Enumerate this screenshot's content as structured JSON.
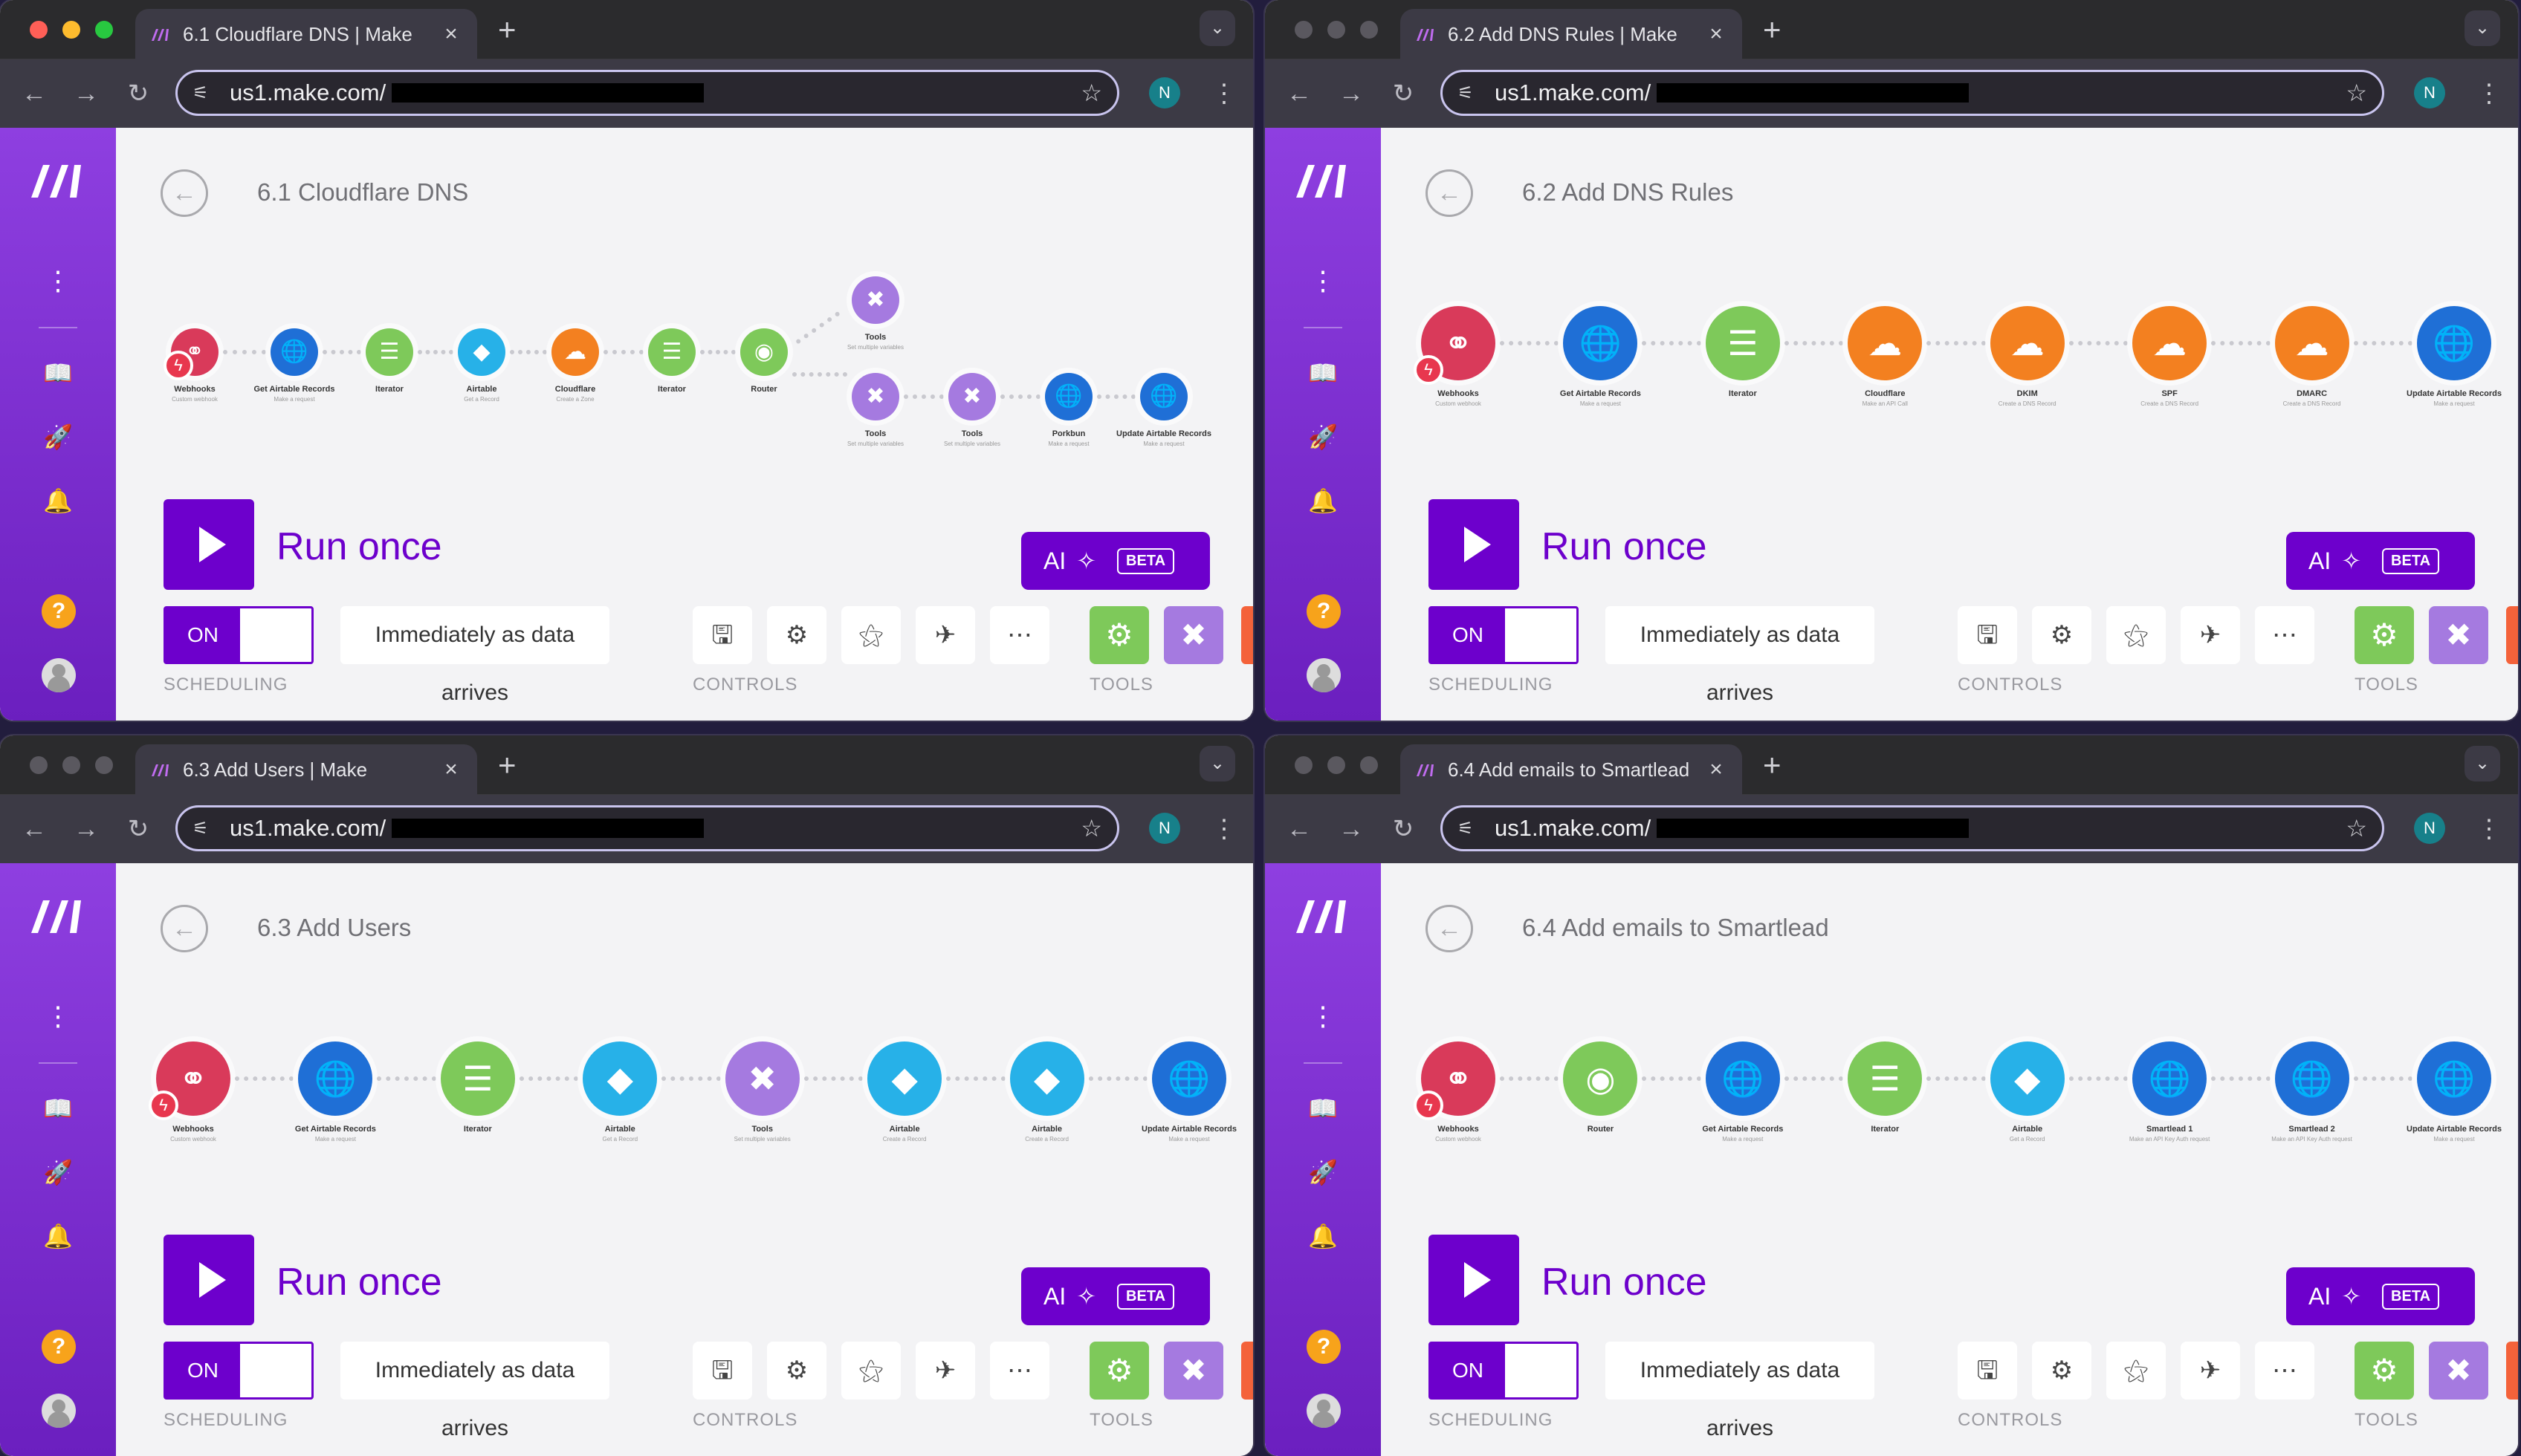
{
  "browser": {
    "url_prefix": "us1.make.com/",
    "profile_initial": "N",
    "new_tab": "+",
    "tab_close": "×",
    "icons": {
      "back": "arrow-left-icon",
      "forward": "arrow-right-icon",
      "reload": "reload-icon",
      "site-settings": "tune-icon",
      "bookmark": "star-icon",
      "menu": "kebab-icon"
    }
  },
  "windows": [
    {
      "tab_title": "6.1 Cloudflare DNS | Make",
      "scenario_title": "6.1 Cloudflare DNS",
      "active": true
    },
    {
      "tab_title": "6.2 Add DNS Rules | Make",
      "scenario_title": "6.2 Add DNS Rules",
      "active": false
    },
    {
      "tab_title": "6.3 Add Users | Make",
      "scenario_title": "6.3 Add Users",
      "active": false
    },
    {
      "tab_title": "6.4 Add emails to Smartlead |",
      "scenario_title": "6.4 Add emails to Smartlead",
      "active": false
    }
  ],
  "flows": [
    [
      {
        "label": "Webhooks",
        "sub": "Custom webhook",
        "color": "#d93a5a",
        "icon": "webhook-icon"
      },
      {
        "label": "Get Airtable Records",
        "sub": "Make a request",
        "color": "#1f6fd6",
        "icon": "globe-icon"
      },
      {
        "label": "Iterator",
        "sub": "",
        "color": "#7ec95a",
        "icon": "iterator-icon"
      },
      {
        "label": "Airtable",
        "sub": "Get a Record",
        "color": "#27b1e8",
        "icon": "airtable-icon"
      },
      {
        "label": "Cloudflare",
        "sub": "Create a Zone",
        "color": "#f38020",
        "icon": "cloud-icon"
      },
      {
        "label": "Iterator",
        "sub": "",
        "color": "#7ec95a",
        "icon": "iterator-icon"
      },
      {
        "label": "Router",
        "sub": "",
        "color": "#7ec95a",
        "icon": "router-icon"
      },
      {
        "label": "Tools",
        "sub": "Set multiple variables",
        "color": "#a57ae0",
        "icon": "tools-icon"
      },
      {
        "label": "Tools",
        "sub": "Set multiple variables",
        "color": "#a57ae0",
        "icon": "tools-icon"
      },
      {
        "label": "Tools",
        "sub": "Set multiple variables",
        "color": "#a57ae0",
        "icon": "tools-icon"
      },
      {
        "label": "Porkbun",
        "sub": "Make a request",
        "color": "#1f6fd6",
        "icon": "globe-icon"
      },
      {
        "label": "Update Airtable Records",
        "sub": "Make a request",
        "color": "#1f6fd6",
        "icon": "globe-icon"
      }
    ],
    [
      {
        "label": "Webhooks",
        "sub": "Custom webhook",
        "color": "#d93a5a",
        "icon": "webhook-icon"
      },
      {
        "label": "Get Airtable Records",
        "sub": "Make a request",
        "color": "#1f6fd6",
        "icon": "globe-icon"
      },
      {
        "label": "Iterator",
        "sub": "",
        "color": "#7ec95a",
        "icon": "iterator-icon"
      },
      {
        "label": "Cloudflare",
        "sub": "Make an API Call",
        "color": "#f38020",
        "icon": "cloud-icon"
      },
      {
        "label": "DKIM",
        "sub": "Create a DNS Record",
        "color": "#f38020",
        "icon": "cloud-icon"
      },
      {
        "label": "SPF",
        "sub": "Create a DNS Record",
        "color": "#f38020",
        "icon": "cloud-icon"
      },
      {
        "label": "DMARC",
        "sub": "Create a DNS Record",
        "color": "#f38020",
        "icon": "cloud-icon"
      },
      {
        "label": "Update Airtable Records",
        "sub": "Make a request",
        "color": "#1f6fd6",
        "icon": "globe-icon"
      }
    ],
    [
      {
        "label": "Webhooks",
        "sub": "Custom webhook",
        "color": "#d93a5a",
        "icon": "webhook-icon"
      },
      {
        "label": "Get Airtable Records",
        "sub": "Make a request",
        "color": "#1f6fd6",
        "icon": "globe-icon"
      },
      {
        "label": "Iterator",
        "sub": "",
        "color": "#7ec95a",
        "icon": "iterator-icon"
      },
      {
        "label": "Airtable",
        "sub": "Get a Record",
        "color": "#27b1e8",
        "icon": "airtable-icon"
      },
      {
        "label": "Tools",
        "sub": "Set multiple variables",
        "color": "#a57ae0",
        "icon": "tools-icon"
      },
      {
        "label": "Airtable",
        "sub": "Create a Record",
        "color": "#27b1e8",
        "icon": "airtable-icon"
      },
      {
        "label": "Airtable",
        "sub": "Create a Record",
        "color": "#27b1e8",
        "icon": "airtable-icon"
      },
      {
        "label": "Update Airtable Records",
        "sub": "Make a request",
        "color": "#1f6fd6",
        "icon": "globe-icon"
      }
    ],
    [
      {
        "label": "Webhooks",
        "sub": "Custom webhook",
        "color": "#d93a5a",
        "icon": "webhook-icon"
      },
      {
        "label": "Router",
        "sub": "",
        "color": "#7ec95a",
        "icon": "router-icon"
      },
      {
        "label": "Get Airtable Records",
        "sub": "Make a request",
        "color": "#1f6fd6",
        "icon": "globe-icon"
      },
      {
        "label": "Iterator",
        "sub": "",
        "color": "#7ec95a",
        "icon": "iterator-icon"
      },
      {
        "label": "Airtable",
        "sub": "Get a Record",
        "color": "#27b1e8",
        "icon": "airtable-icon"
      },
      {
        "label": "Smartlead 1",
        "sub": "Make an API Key Auth request",
        "color": "#1f6fd6",
        "icon": "globe-icon"
      },
      {
        "label": "Smartlead 2",
        "sub": "Make an API Key Auth request",
        "color": "#1f6fd6",
        "icon": "globe-icon"
      },
      {
        "label": "Update Airtable Records",
        "sub": "Make a request",
        "color": "#1f6fd6",
        "icon": "globe-icon"
      }
    ]
  ],
  "editor": {
    "run_once": "Run once",
    "ai_label": "AI",
    "ai_beta": "BETA",
    "toggle_on": "ON",
    "schedule_text": "Immediately as data arrives",
    "scheduling_caption": "SCHEDULING",
    "controls_caption": "CONTROLS",
    "tools_caption": "TOOLS",
    "controls": [
      "save-icon",
      "gear-icon",
      "magic-wand-icon",
      "airplane-icon",
      "more-icon"
    ],
    "tools": [
      {
        "icon": "gear-icon",
        "color": "#7ec95a"
      },
      {
        "icon": "tools-icon",
        "color": "#a57ae0"
      }
    ]
  },
  "colors": {
    "accent": "#6d00cc",
    "sidebar_top": "#8e3fe0",
    "sidebar_bottom": "#6b1fbf"
  }
}
